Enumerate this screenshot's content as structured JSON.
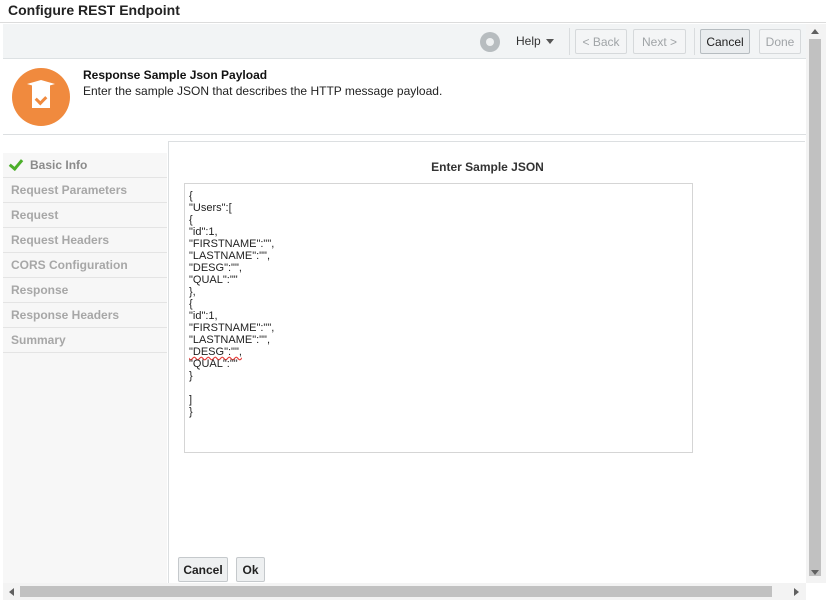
{
  "window": {
    "title": "Configure REST Endpoint"
  },
  "toolbar": {
    "help_label": "Help",
    "back_label": "< Back",
    "next_label": "Next >",
    "cancel_label": "Cancel",
    "done_label": "Done"
  },
  "header": {
    "title": "Response Sample Json Payload",
    "description": "Enter the sample JSON that describes the HTTP message payload."
  },
  "sidebar": {
    "items": [
      {
        "label": "Basic Info",
        "completed": true
      },
      {
        "label": "Request Parameters",
        "completed": false
      },
      {
        "label": "Request",
        "completed": false
      },
      {
        "label": "Request Headers",
        "completed": false
      },
      {
        "label": "CORS Configuration",
        "completed": false
      },
      {
        "label": "Response",
        "completed": false
      },
      {
        "label": "Response Headers",
        "completed": false
      },
      {
        "label": "Summary",
        "completed": false
      }
    ]
  },
  "content": {
    "title": "Enter Sample JSON",
    "json_lines": [
      "{",
      "\"Users\":[",
      "{",
      "\"id\":1,",
      "\"FIRSTNAME\":\"\",",
      "\"LASTNAME\":\"\",",
      "\"DESG\":\"\",",
      "\"QUAL\":\"\"",
      "},",
      "{",
      "\"id\":1,",
      "\"FIRSTNAME\":\"\",",
      "\"LASTNAME\":\"\",",
      "\"DESG\":\"\",",
      "\"QUAL\":\"\"",
      "}",
      "",
      "]",
      "}"
    ],
    "cancel_label": "Cancel",
    "ok_label": "Ok"
  },
  "colors": {
    "accent": "#f08a3e",
    "check": "#4caf2a"
  }
}
